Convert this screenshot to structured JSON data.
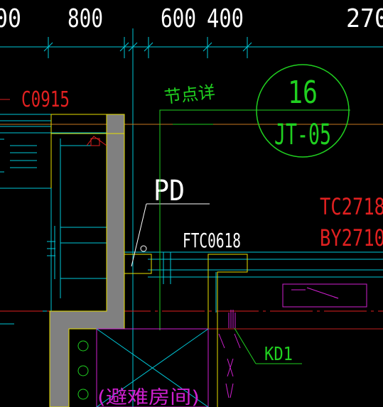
{
  "drawing": {
    "dimensions": {
      "d_left": "00",
      "d_800": "800",
      "d_600": "600",
      "d_400": "400",
      "d_right": "270"
    },
    "window_label": "C0915",
    "detail_label": "节点详",
    "detail_callout": {
      "number": "16",
      "sheet": "JT-05"
    },
    "pd_label": "PD",
    "ftc_label": "FTC0618",
    "tc_label": "TC2718",
    "by_label": "BY2710",
    "kd_label": "KD1",
    "room_label": "(避难房间)",
    "colors": {
      "background": "#000000",
      "white": "#ffffff",
      "cyan": "#00c8d8",
      "red": "#e02020",
      "green": "#20d020",
      "yellow": "#e8e000",
      "magenta": "#d020d0",
      "wall_fill": "#808080"
    }
  }
}
